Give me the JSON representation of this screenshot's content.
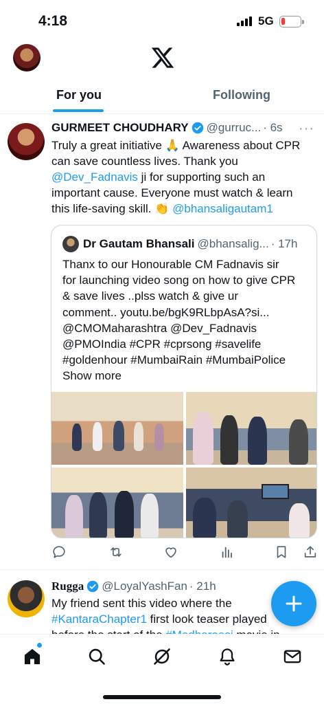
{
  "status_bar": {
    "time": "4:18",
    "network": "5G"
  },
  "tabs": [
    {
      "label": "For you",
      "active": true
    },
    {
      "label": "Following",
      "active": false
    }
  ],
  "tweet1": {
    "name": "GURMEET CHOUDHARY",
    "handle": "@gurruc...",
    "time": "· 6s",
    "body_parts": {
      "t1": "Truly a great initiative 🙏 Awareness about CPR can save countless lives. Thank you ",
      "mention1": "@Dev_Fadnavis",
      "t2": " ji for supporting such an important cause. Everyone must watch & learn this life-saving skill. 👏 ",
      "mention2": "@bhansaligautam1"
    },
    "quote": {
      "name": "Dr Gautam Bhansali",
      "handle": "@bhansalig...",
      "time": "· 17h",
      "text": "Thanx to our Honourable CM Fadnavis sir for launching video song on how to give CPR & save lives ..plss watch & give ur comment.. youtu.be/bgK9RLbpAsA?si... @CMOMaharashtra @Dev_Fadnavis @PMOIndia #CPR #cprsong #savelife #goldenhour #MumbaiRain #MumbaiPolice",
      "show_more": "Show more"
    }
  },
  "tweet2": {
    "name": "Rugga",
    "handle": "@LoyalYashFan",
    "time": "· 21h",
    "t1": "My friend sent this video where the ",
    "hashtag1": "#KantaraChapter1",
    "t2": " first look teaser played before the start of the ",
    "hashtag2": "#Madharaasi",
    "t3": " movie in"
  },
  "icons": {
    "nav": [
      "home-icon",
      "search-icon",
      "grok-icon",
      "notifications-icon",
      "messages-icon"
    ],
    "actions": [
      "reply-icon",
      "repost-icon",
      "like-icon",
      "views-icon",
      "bookmark-icon",
      "share-icon"
    ]
  },
  "colors": {
    "accent": "#1d9bf0",
    "text": "#0f1419",
    "muted": "#536471"
  }
}
